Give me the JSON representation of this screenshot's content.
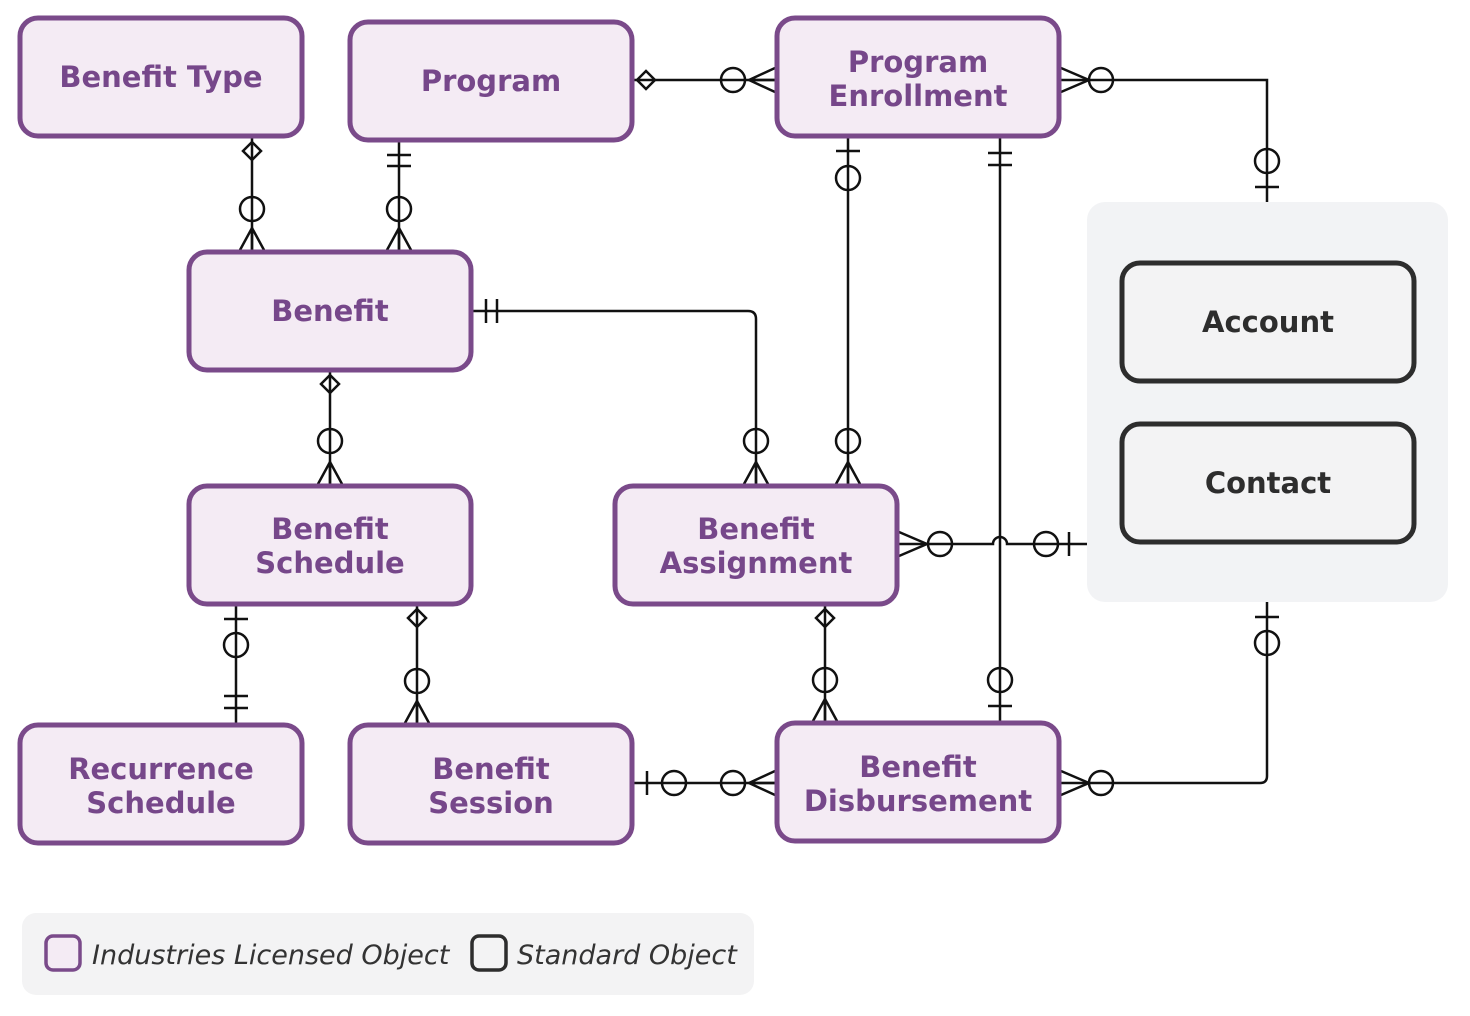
{
  "entities": {
    "benefit_type": "Benefit Type",
    "program": "Program",
    "program_enrollment": [
      "Program",
      "Enrollment"
    ],
    "benefit": "Benefit",
    "benefit_schedule": [
      "Benefit",
      "Schedule"
    ],
    "benefit_assignment": [
      "Benefit",
      "Assignment"
    ],
    "recurrence_schedule": [
      "Recurrence",
      "Schedule"
    ],
    "benefit_session": [
      "Benefit",
      "Session"
    ],
    "benefit_disbursement": [
      "Benefit",
      "Disbursement"
    ],
    "account": "Account",
    "contact": "Contact"
  },
  "legend": {
    "licensed": "Industries Licensed Object",
    "standard": "Standard Object"
  },
  "colors": {
    "licensed_border": "#7a4a8a",
    "licensed_fill": "#f4ebf4",
    "licensed_text": "#76478a",
    "standard_border": "#2d2d2d",
    "panel_bg": "#f2f3f5"
  }
}
